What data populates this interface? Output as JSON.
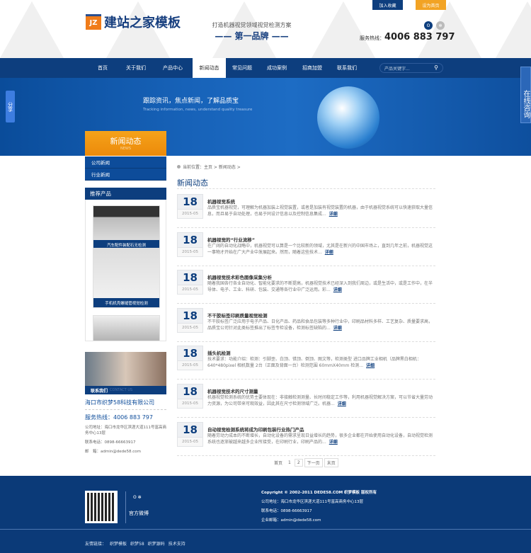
{
  "header": {
    "logo_badge": "JZ",
    "logo_text": "建站之家模板",
    "slogan_line1": "打造机器视觉领域视觉检测方案",
    "slogan_line2": "—— 第一品牌 ——",
    "top_buttons": [
      "加入收藏",
      "设为首页"
    ],
    "hotline_label": "服务热线：",
    "hotline_number": "4006 883 797"
  },
  "nav": {
    "items": [
      "首页",
      "关于我们",
      "产品中心",
      "新闻动态",
      "常见问题",
      "成功案例",
      "招商加盟",
      "联系我们"
    ],
    "active": "新闻动态",
    "search_placeholder": "产品关键字..."
  },
  "banner": {
    "title": "跟踪资讯，焦点新闻，了解品质宝",
    "subtitle": "Tracking information, news, understand quality treasure"
  },
  "floating": {
    "share": "分享",
    "consult": "在线咨询"
  },
  "sidebar": {
    "heading": "新闻动态",
    "heading_en": "NEWS",
    "categories": [
      "公司新闻",
      "行业新闻"
    ],
    "recommend_heading": "推荐产品",
    "products": [
      "汽车配件装配石无检测",
      "手机机壳螺缝管视觉检测",
      ""
    ],
    "contact_caption": "联系我们",
    "contact_caption_en": "CONTACT US",
    "company": "海口市织梦58科技有限公司",
    "hotline": "服务热线：4006 883 797",
    "address": "公司地址：海口市龙华区滨涯大道111号富高商务中心13层",
    "phone": "联系电话：0898-66663917",
    "email": "邮　箱：admin@dede58.com"
  },
  "main": {
    "breadcrumb": "当前位置：主页 > 新闻动态 >",
    "title": "新闻动态",
    "more_label": "详细",
    "news": [
      {
        "day": "18",
        "month": "2015-05",
        "title": "机器视觉系统",
        "desc": "品质宝机器视觉，可理解为机器加装上视觉装置，或者是加装有视觉装置的机器，由于机器视觉系统可以快速获取大量信息，而且易于自动处理，也易于同设计信息以及控制信息集成..."
      },
      {
        "day": "18",
        "month": "2015-05",
        "title": "机器视觉的“行业流移”",
        "desc": "在广阔的自动化战略中，机器视觉可以算是一个比较新的领域，尤其是在新兴的中国市场上，直到几年之前，机器视觉这一事物才开始在广大产业中发展起来。然而，随着这些技术..."
      },
      {
        "day": "18",
        "month": "2015-05",
        "title": "机器视觉技术彩色图像采集分析",
        "desc": "随着我国各行各业自动化、智能化要求的不断提高，机器视觉技术已经深入到我们周边，或是生活中，或是工作中，在半导体、电子、工业、科研、包装、交通等各行业中广泛运用。彩..."
      },
      {
        "day": "18",
        "month": "2015-05",
        "title": "不干胶标签印刷质量视觉检测",
        "desc": "不干胶标签广泛应用于电子产品、日化产品、药品和食品包装等多种行业中，印刷品材料多样、工艺复杂、质量要求高，品质宝公司针对此类标签推出了标签专检设备，检测标签缺陷的..."
      },
      {
        "day": "18",
        "month": "2015-05",
        "title": "插头机检测",
        "desc": "技术要求：功能介绍：检测：引脚歪、白顶、错顶、倒顶、图文等，检测类型 进口品牌工业相机（品牌黑白相机：640*480pixel 相机数量 2台（正面及背面一台）检测范围 60mmX40mm 检测..."
      },
      {
        "day": "18",
        "month": "2015-05",
        "title": "机器视觉技术的尺寸测量",
        "desc": "机器视觉检测系统的优势主要体现在：非接触检测测量、长时间稳定工作等，利用机器视觉解决方案，可以节省大量劳动力资源，为公司带来可观效益，因此其在尺寸检测领域广泛。机器..."
      },
      {
        "day": "18",
        "month": "2015-05",
        "title": "自动视觉检测系统将成为印刷包装行业热门产品",
        "desc": "随着劳动力成本的不断增长，自动化设备的需求呈现日益增长的趋势，很多企业都在开始使用自动化设备，自动视觉检测系统也逐渐被越来越多企业所接受，在印刷行业，印刷产品的..."
      }
    ],
    "pager": [
      "首页",
      "1",
      "2",
      "下一页",
      "末页"
    ]
  },
  "footer": {
    "weibo_label": "官方微博",
    "copyright": "Copyright © 2002-2011 DEDE58.COM 织梦模板 版权所有",
    "address": "公司地址：海口市龙华区滨涯大道111号富高商务中心13层",
    "phone": "联系电话：0898-66663917",
    "email": "企业邮箱：admin@dede58.com",
    "links_label": "友情链接：",
    "links": [
      "织梦模板",
      "织梦58",
      "织梦源码",
      "技术支持"
    ]
  },
  "colors": {
    "primary": "#0d3e7e",
    "accent": "#f07c1a",
    "footer": "#0b3a78"
  }
}
